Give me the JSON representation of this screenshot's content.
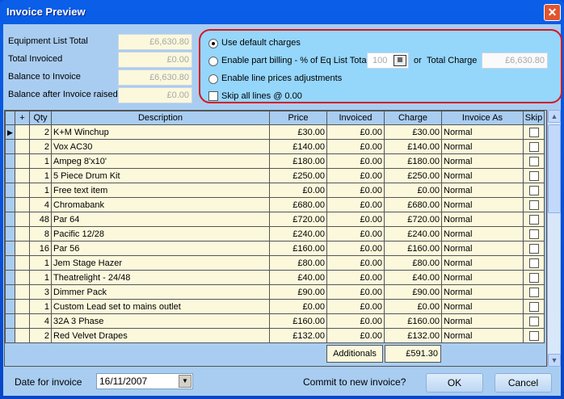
{
  "window": {
    "title": "Invoice Preview",
    "close_icon": "close-icon"
  },
  "summary": [
    {
      "label": "Equipment List Total",
      "value": "£6,630.80"
    },
    {
      "label": "Total Invoiced",
      "value": "£0.00"
    },
    {
      "label": "Balance to Invoice",
      "value": "£6,630.80"
    },
    {
      "label": "Balance after Invoice raised",
      "value": "£0.00"
    }
  ],
  "options": {
    "default_charges": "Use default charges",
    "part_billing": "Enable part billing - % of Eq List Total",
    "percent": "100",
    "or": "or",
    "total_charge_label": "Total Charge",
    "total_charge": "£6,630.80",
    "line_adjust": "Enable line prices adjustments",
    "skip_all": "Skip all lines @ 0.00",
    "selected": "default_charges"
  },
  "grid": {
    "columns": [
      "+",
      "Qty",
      "Description",
      "Price",
      "Invoiced",
      "Charge",
      "Invoice As",
      "Skip"
    ],
    "rows": [
      {
        "qty": "2",
        "desc": "K+M Winchup",
        "price": "£30.00",
        "invoiced": "£0.00",
        "charge": "£30.00",
        "as": "Normal"
      },
      {
        "qty": "2",
        "desc": "Vox AC30",
        "price": "£140.00",
        "invoiced": "£0.00",
        "charge": "£140.00",
        "as": "Normal"
      },
      {
        "qty": "1",
        "desc": "Ampeg 8'x10'",
        "price": "£180.00",
        "invoiced": "£0.00",
        "charge": "£180.00",
        "as": "Normal"
      },
      {
        "qty": "1",
        "desc": "5 Piece Drum Kit",
        "price": "£250.00",
        "invoiced": "£0.00",
        "charge": "£250.00",
        "as": "Normal"
      },
      {
        "qty": "1",
        "desc": "Free text item",
        "price": "£0.00",
        "invoiced": "£0.00",
        "charge": "£0.00",
        "as": "Normal"
      },
      {
        "qty": "4",
        "desc": "Chromabank",
        "price": "£680.00",
        "invoiced": "£0.00",
        "charge": "£680.00",
        "as": "Normal"
      },
      {
        "qty": "48",
        "desc": "Par 64",
        "price": "£720.00",
        "invoiced": "£0.00",
        "charge": "£720.00",
        "as": "Normal"
      },
      {
        "qty": "8",
        "desc": "Pacific 12/28",
        "price": "£240.00",
        "invoiced": "£0.00",
        "charge": "£240.00",
        "as": "Normal"
      },
      {
        "qty": "16",
        "desc": "Par 56",
        "price": "£160.00",
        "invoiced": "£0.00",
        "charge": "£160.00",
        "as": "Normal"
      },
      {
        "qty": "1",
        "desc": "Jem Stage Hazer",
        "price": "£80.00",
        "invoiced": "£0.00",
        "charge": "£80.00",
        "as": "Normal"
      },
      {
        "qty": "1",
        "desc": "Theatrelight - 24/48",
        "price": "£40.00",
        "invoiced": "£0.00",
        "charge": "£40.00",
        "as": "Normal"
      },
      {
        "qty": "3",
        "desc": "Dimmer Pack",
        "price": "£90.00",
        "invoiced": "£0.00",
        "charge": "£90.00",
        "as": "Normal"
      },
      {
        "qty": "1",
        "desc": "Custom Lead set to mains outlet",
        "price": "£0.00",
        "invoiced": "£0.00",
        "charge": "£0.00",
        "as": "Normal"
      },
      {
        "qty": "4",
        "desc": "32A 3 Phase",
        "price": "£160.00",
        "invoiced": "£0.00",
        "charge": "£160.00",
        "as": "Normal"
      },
      {
        "qty": "2",
        "desc": "Red Velvet Drapes",
        "price": "£132.00",
        "invoiced": "£0.00",
        "charge": "£132.00",
        "as": "Normal"
      }
    ],
    "additionals_label": "Additionals",
    "additionals_value": "£591.30"
  },
  "footer": {
    "date_label": "Date for invoice",
    "date": "16/11/2007",
    "commit": "Commit to new invoice?",
    "ok": "OK",
    "cancel": "Cancel"
  }
}
